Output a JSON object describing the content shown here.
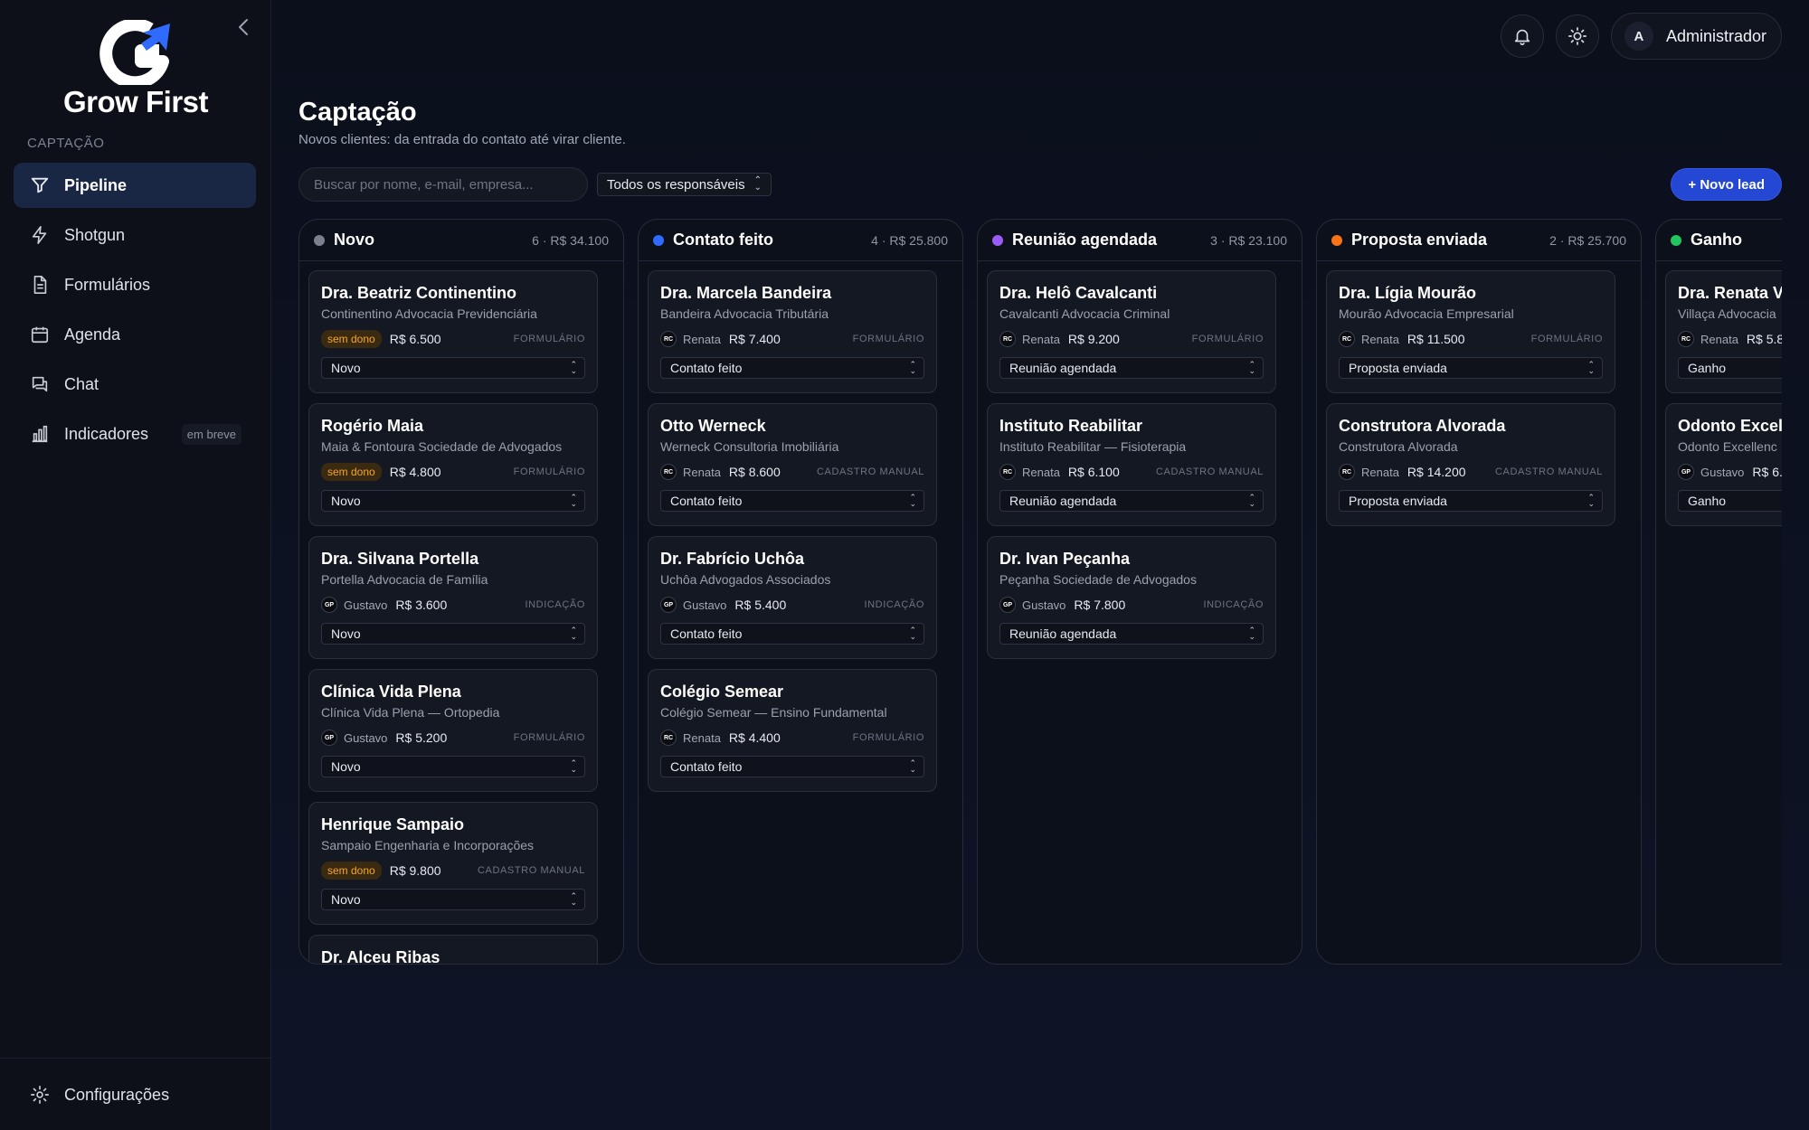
{
  "app": {
    "name": "Grow First",
    "collapse_icon": "chevron-left-icon"
  },
  "sidebar": {
    "section_label": "CAPTAÇÃO",
    "items": [
      {
        "label": "Pipeline",
        "icon": "funnel-icon",
        "active": true
      },
      {
        "label": "Shotgun",
        "icon": "bolt-icon"
      },
      {
        "label": "Formulários",
        "icon": "document-icon"
      },
      {
        "label": "Agenda",
        "icon": "calendar-icon"
      },
      {
        "label": "Chat",
        "icon": "chat-icon"
      },
      {
        "label": "Indicadores",
        "icon": "bar-chart-icon",
        "badge": "em breve"
      }
    ],
    "footer": {
      "label": "Configurações",
      "icon": "gear-icon"
    }
  },
  "header": {
    "user_initial": "A",
    "user_name": "Administrador"
  },
  "page": {
    "title": "Captação",
    "subtitle": "Novos clientes: da entrada do contato até virar cliente."
  },
  "toolbar": {
    "search_placeholder": "Buscar por nome, e-mail, empresa...",
    "filter_label": "Todos os responsáveis",
    "new_lead_label": "+ Novo lead"
  },
  "colors": {
    "accent": "#2447d4",
    "novo": "#7a808e",
    "contato": "#2f6bff",
    "reuniao": "#9b5cf6",
    "proposta": "#f97316",
    "ganho": "#22c55e",
    "sem_dono": "#f5a623"
  },
  "columns": [
    {
      "title": "Novo",
      "meta": "6 · R$ 34.100",
      "cards": [
        {
          "name": "Dra. Beatriz Continentino",
          "company": "Continentino Advocacia Previdenciária",
          "sem_dono": "sem dono",
          "value": "R$ 6.500",
          "source": "FORMULÁRIO",
          "stage": "Novo"
        },
        {
          "name": "Rogério Maia",
          "company": "Maia & Fontoura Sociedade de Advogados",
          "sem_dono": "sem dono",
          "value": "R$ 4.800",
          "source": "FORMULÁRIO",
          "stage": "Novo"
        },
        {
          "name": "Dra. Silvana Portella",
          "company": "Portella Advocacia de Família",
          "owner_initials": "GP",
          "owner": "Gustavo",
          "value": "R$ 3.600",
          "source": "INDICAÇÃO",
          "stage": "Novo"
        },
        {
          "name": "Clínica Vida Plena",
          "company": "Clínica Vida Plena — Ortopedia",
          "owner_initials": "GP",
          "owner": "Gustavo",
          "value": "R$ 5.200",
          "source": "FORMULÁRIO",
          "stage": "Novo"
        },
        {
          "name": "Henrique Sampaio",
          "company": "Sampaio Engenharia e Incorporações",
          "sem_dono": "sem dono",
          "value": "R$ 9.800",
          "source": "CADASTRO MANUAL",
          "stage": "Novo"
        },
        {
          "name": "Dr. Alceu Ribas",
          "company": "",
          "partial": true
        }
      ]
    },
    {
      "title": "Contato feito",
      "meta": "4 · R$ 25.800",
      "cards": [
        {
          "name": "Dra. Marcela Bandeira",
          "company": "Bandeira Advocacia Tributária",
          "owner_initials": "RC",
          "owner": "Renata",
          "value": "R$ 7.400",
          "source": "FORMULÁRIO",
          "stage": "Contato feito"
        },
        {
          "name": "Otto Werneck",
          "company": "Werneck Consultoria Imobiliária",
          "owner_initials": "RC",
          "owner": "Renata",
          "value": "R$ 8.600",
          "source": "CADASTRO MANUAL",
          "stage": "Contato feito"
        },
        {
          "name": "Dr. Fabrício Uchôa",
          "company": "Uchôa Advogados Associados",
          "owner_initials": "GP",
          "owner": "Gustavo",
          "value": "R$ 5.400",
          "source": "INDICAÇÃO",
          "stage": "Contato feito"
        },
        {
          "name": "Colégio Semear",
          "company": "Colégio Semear — Ensino Fundamental",
          "owner_initials": "RC",
          "owner": "Renata",
          "value": "R$ 4.400",
          "source": "FORMULÁRIO",
          "stage": "Contato feito"
        }
      ]
    },
    {
      "title": "Reunião agendada",
      "meta": "3 · R$ 23.100",
      "cards": [
        {
          "name": "Dra. Helô Cavalcanti",
          "company": "Cavalcanti Advocacia Criminal",
          "owner_initials": "RC",
          "owner": "Renata",
          "value": "R$ 9.200",
          "source": "FORMULÁRIO",
          "stage": "Reunião agendada"
        },
        {
          "name": "Instituto Reabilitar",
          "company": "Instituto Reabilitar — Fisioterapia",
          "owner_initials": "RC",
          "owner": "Renata",
          "value": "R$ 6.100",
          "source": "CADASTRO MANUAL",
          "stage": "Reunião agendada"
        },
        {
          "name": "Dr. Ivan Peçanha",
          "company": "Peçanha Sociedade de Advogados",
          "owner_initials": "GP",
          "owner": "Gustavo",
          "value": "R$ 7.800",
          "source": "INDICAÇÃO",
          "stage": "Reunião agendada"
        }
      ]
    },
    {
      "title": "Proposta enviada",
      "meta": "2 · R$ 25.700",
      "cards": [
        {
          "name": "Dra. Lígia Mourão",
          "company": "Mourão Advocacia Empresarial",
          "owner_initials": "RC",
          "owner": "Renata",
          "value": "R$ 11.500",
          "source": "FORMULÁRIO",
          "stage": "Proposta enviada"
        },
        {
          "name": "Construtora Alvorada",
          "company": "Construtora Alvorada",
          "owner_initials": "RC",
          "owner": "Renata",
          "value": "R$ 14.200",
          "source": "CADASTRO MANUAL",
          "stage": "Proposta enviada"
        }
      ]
    },
    {
      "title": "Ganho",
      "meta": "",
      "cards": [
        {
          "name": "Dra. Renata V",
          "company": "Villaça Advocacia",
          "owner_initials": "RC",
          "owner": "Renata",
          "value": "R$ 5.8",
          "source": "",
          "stage": "Ganho"
        },
        {
          "name": "Odonto Excell",
          "company": "Odonto Excellenc",
          "owner_initials": "GP",
          "owner": "Gustavo",
          "value": "R$ 6.",
          "source": "",
          "stage": "Ganho"
        }
      ]
    }
  ]
}
